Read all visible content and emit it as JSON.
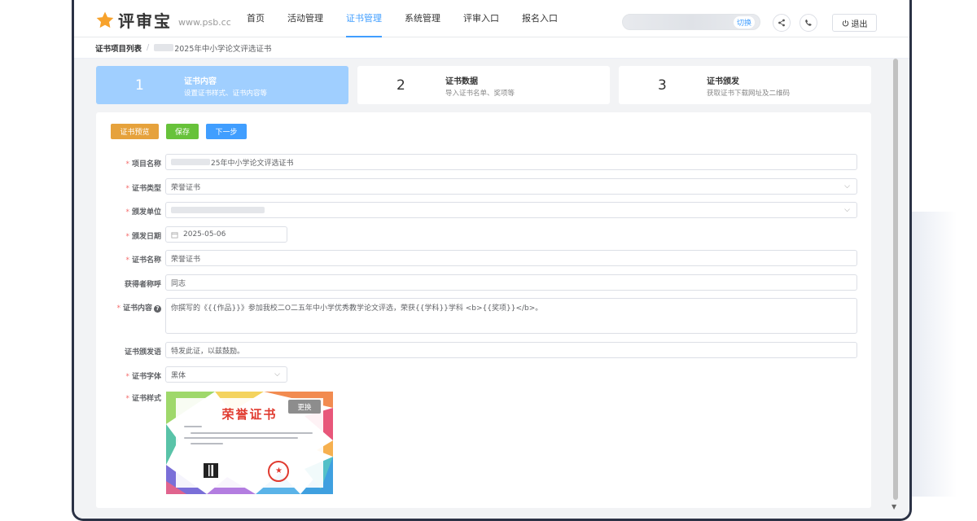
{
  "app": {
    "logo_text": "评审宝",
    "logo_url": "www.psb.cc"
  },
  "nav": {
    "items": [
      "首页",
      "活动管理",
      "证书管理",
      "系统管理",
      "评审入口",
      "报名入口"
    ],
    "active": "证书管理",
    "switch_label": "切换",
    "logout_label": "退出"
  },
  "breadcrumb": {
    "parent": "证书项目列表",
    "separator": "/",
    "current": "2025年中小学论文评选证书"
  },
  "steps": [
    {
      "num": "1",
      "title": "证书内容",
      "desc": "设置证书样式、证书内容等"
    },
    {
      "num": "2",
      "title": "证书数据",
      "desc": "导入证书名单、奖项等"
    },
    {
      "num": "3",
      "title": "证书颁发",
      "desc": "获取证书下载网址及二维码"
    }
  ],
  "toolbar": {
    "preview_label": "证书预览",
    "save_label": "保存",
    "next_label": "下一步"
  },
  "form": {
    "project_name_label": "项目名称",
    "project_name_value": "25年中小学论文评选证书",
    "cert_type_label": "证书类型",
    "cert_type_value": "荣誉证书",
    "issuer_label": "颁发单位",
    "issue_date_label": "颁发日期",
    "issue_date_value": "2025-05-06",
    "cert_name_label": "证书名称",
    "cert_name_value": "荣誉证书",
    "honorific_label": "获得者称呼",
    "honorific_value": "同志",
    "content_label": "证书内容",
    "content_value": "你撰写的《{{作品}}》参加我校二O二五年中小学优秀教学论文评选，荣获{{学科}}学科 <b>{{奖项}}</b>。",
    "closing_label": "证书颁发语",
    "closing_value": "特发此证，以兹鼓励。",
    "font_label": "证书字体",
    "font_value": "黑体",
    "style_label": "证书样式"
  },
  "certificate": {
    "title": "荣誉证书",
    "replace_label": "更换"
  },
  "colors": {
    "primary": "#409eff",
    "warning": "#e6a23c",
    "success": "#67c23a",
    "required": "#f56c6c",
    "step_active": "#a0cfff"
  }
}
